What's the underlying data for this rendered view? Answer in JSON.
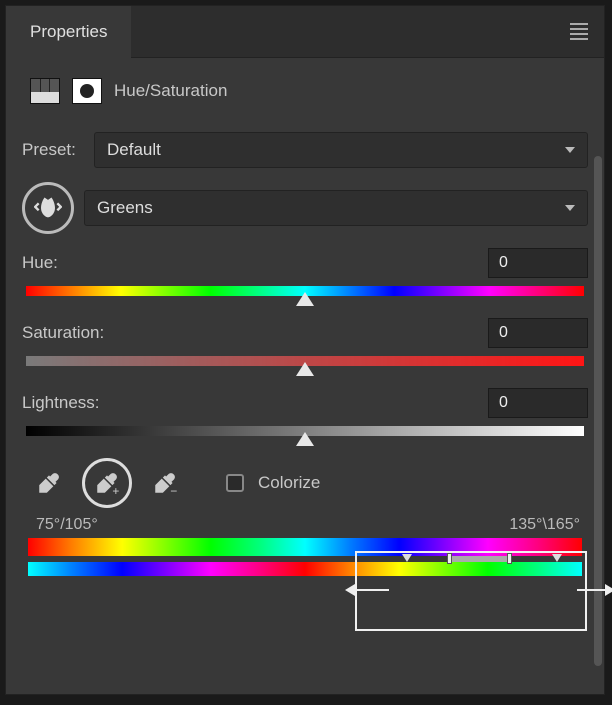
{
  "panel": {
    "title": "Properties",
    "adjustment_name": "Hue/Saturation"
  },
  "preset": {
    "label": "Preset:",
    "value": "Default"
  },
  "channel": {
    "value": "Greens"
  },
  "sliders": {
    "hue": {
      "label": "Hue:",
      "value": "0"
    },
    "saturation": {
      "label": "Saturation:",
      "value": "0"
    },
    "lightness": {
      "label": "Lightness:",
      "value": "0"
    }
  },
  "colorize": {
    "label": "Colorize",
    "checked": false
  },
  "range": {
    "left_label": "75°/105°",
    "right_label": "135°\\165°"
  }
}
